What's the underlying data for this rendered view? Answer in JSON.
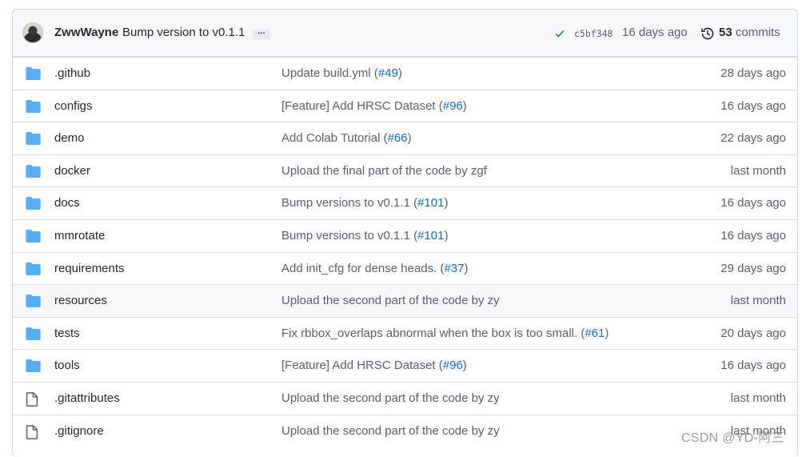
{
  "header": {
    "author": "ZwwWayne",
    "message": "Bump version to v0.1.1",
    "ellipsis": "…",
    "sha": "c5bf348",
    "time": "16 days ago",
    "commits_count": "53",
    "commits_label": "commits"
  },
  "rows": [
    {
      "type": "dir",
      "name": ".github",
      "msg": "Update build.yml (",
      "pr": "#49",
      "tail": ")",
      "age": "28 days ago"
    },
    {
      "type": "dir",
      "name": "configs",
      "msg": "[Feature] Add HRSC Dataset (",
      "pr": "#96",
      "tail": ")",
      "age": "16 days ago"
    },
    {
      "type": "dir",
      "name": "demo",
      "msg": "Add Colab Tutorial (",
      "pr": "#66",
      "tail": ")",
      "age": "22 days ago"
    },
    {
      "type": "dir",
      "name": "docker",
      "msg": "Upload the final part of the code by zgf",
      "pr": "",
      "tail": "",
      "age": "last month"
    },
    {
      "type": "dir",
      "name": "docs",
      "msg": "Bump versions to v0.1.1 (",
      "pr": "#101",
      "tail": ")",
      "age": "16 days ago"
    },
    {
      "type": "dir",
      "name": "mmrotate",
      "msg": "Bump versions to v0.1.1 (",
      "pr": "#101",
      "tail": ")",
      "age": "16 days ago"
    },
    {
      "type": "dir",
      "name": "requirements",
      "msg": "Add init_cfg for dense heads. (",
      "pr": "#37",
      "tail": ")",
      "age": "29 days ago"
    },
    {
      "type": "dir",
      "name": "resources",
      "msg": "Upload the second part of the code by zy",
      "pr": "",
      "tail": "",
      "age": "last month",
      "highlight": true
    },
    {
      "type": "dir",
      "name": "tests",
      "msg": "Fix rbbox_overlaps abnormal when the box is too small. (",
      "pr": "#61",
      "tail": ")",
      "age": "20 days ago"
    },
    {
      "type": "dir",
      "name": "tools",
      "msg": "[Feature] Add HRSC Dataset (",
      "pr": "#96",
      "tail": ")",
      "age": "16 days ago"
    },
    {
      "type": "file",
      "name": ".gitattributes",
      "msg": "Upload the second part of the code by zy",
      "pr": "",
      "tail": "",
      "age": "last month"
    },
    {
      "type": "file",
      "name": ".gitignore",
      "msg": "Upload the second part of the code by zy",
      "pr": "",
      "tail": "",
      "age": "last month"
    }
  ],
  "watermark": "CSDN @YD-阿三",
  "colors": {
    "folder": "#54aeff",
    "link": "#0969da",
    "check": "#1a7f37"
  }
}
